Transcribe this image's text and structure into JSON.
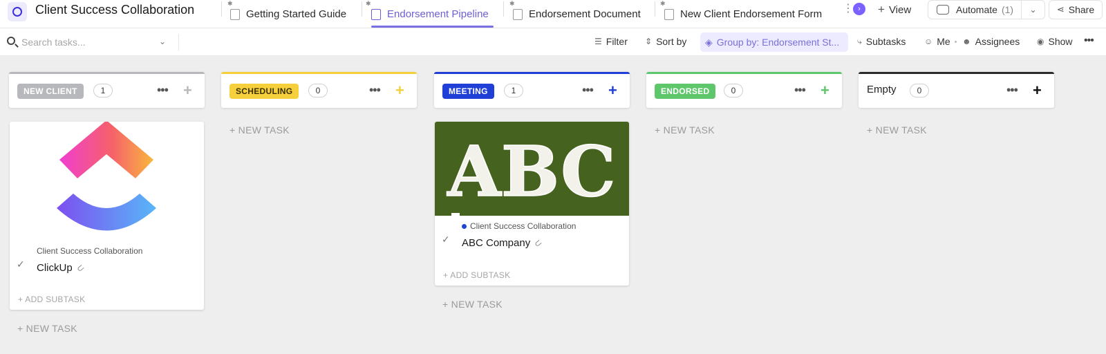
{
  "header": {
    "space_title": "Client Success Collaboration",
    "tabs": [
      {
        "label": "Getting Started Guide"
      },
      {
        "label": "Endorsement Pipeline"
      },
      {
        "label": "Endorsement Document"
      },
      {
        "label": "New Client Endorsement Form"
      }
    ],
    "view_label": "View",
    "automate_label": "Automate",
    "automate_count": "(1)",
    "share_label": "Share"
  },
  "toolbar": {
    "search_placeholder": "Search tasks...",
    "filter_label": "Filter",
    "sort_label": "Sort by",
    "group_by_label": "Group by: Endorsement St...",
    "subtasks_label": "Subtasks",
    "me_label": "Me",
    "assignees_label": "Assignees",
    "show_label": "Show"
  },
  "columns": [
    {
      "status": "NEW CLIENT",
      "count": "1",
      "color": "#b7b8bc",
      "pill_text_color": "#ffffff"
    },
    {
      "status": "SCHEDULING",
      "count": "0",
      "color": "#f5cf3c",
      "pill_text_color": "#3a3000"
    },
    {
      "status": "MEETING",
      "count": "1",
      "color": "#1f3fd6",
      "pill_text_color": "#ffffff"
    },
    {
      "status": "ENDORSED",
      "count": "0",
      "color": "#5fc76b",
      "pill_text_color": "#ffffff"
    },
    {
      "status": "Empty",
      "count": "0",
      "color": "#2b2b2b"
    }
  ],
  "new_task_label": "+ NEW TASK",
  "cards": [
    {
      "location": "Client Success Collaboration",
      "title": "ClickUp",
      "add_subtask": "+ ADD SUBTASK"
    },
    {
      "location": "Client Success Collaboration",
      "title": "ABC Company",
      "add_subtask": "+ ADD SUBTASK",
      "image_text": "ABC"
    }
  ]
}
